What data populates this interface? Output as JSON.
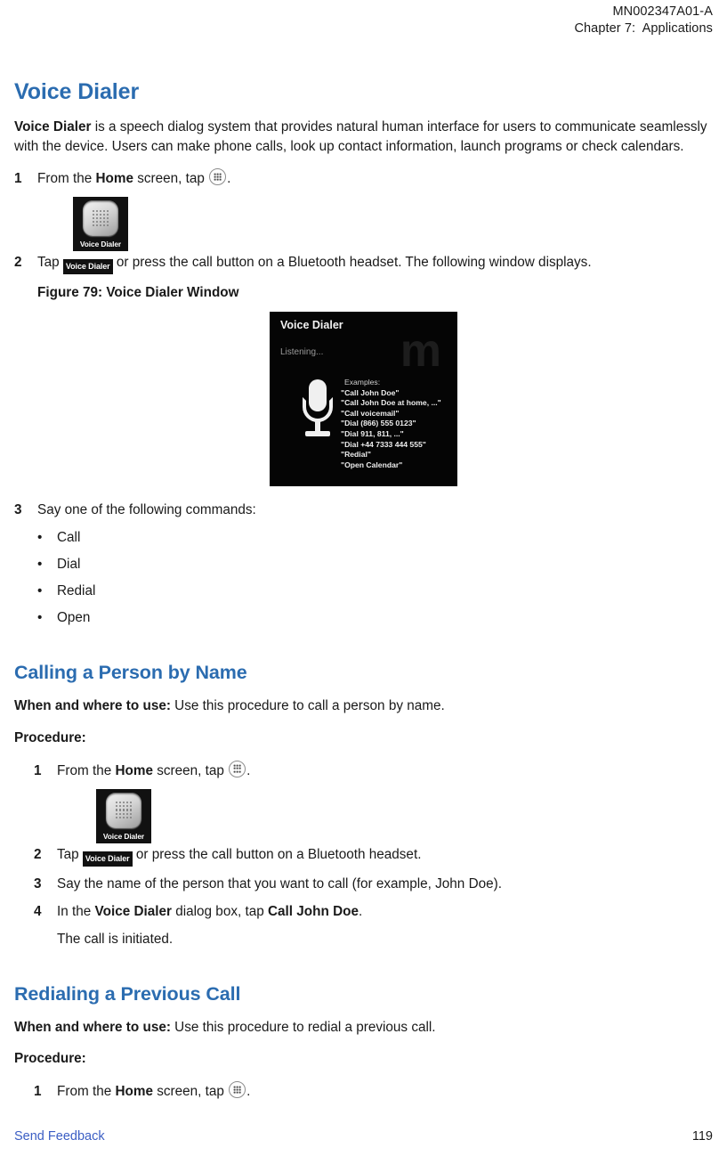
{
  "header": {
    "doc_number": "MN002347A01-A",
    "chapter": "Chapter 7:  Applications"
  },
  "section_voice_dialer": {
    "title": "Voice Dialer",
    "intro_bold": "Voice Dialer",
    "intro_rest": " is a speech dialog system that provides natural human interface for users to communicate seamlessly with the device. Users can make phone calls, look up contact information, launch programs or check calendars.",
    "step1": {
      "num": "1",
      "pre": "From the ",
      "bold": "Home",
      "post": " screen, tap "
    },
    "step2": {
      "num": "2",
      "pre": "Tap ",
      "tile_label": "Voice Dialer",
      "post": " or press the call button on a Bluetooth headset. The following window displays."
    },
    "figure_caption": "Figure 79: Voice Dialer Window",
    "step3": {
      "num": "3",
      "text": "Say one of the following commands:"
    },
    "commands": [
      "Call",
      "Dial",
      "Redial",
      "Open"
    ],
    "app_tile_label": "Voice Dialer"
  },
  "voice_dialer_window": {
    "title": "Voice Dialer",
    "status": "Listening...",
    "examples_heading": "Examples:",
    "examples": [
      "\"Call John Doe\"",
      "\"Call John Doe at home, ...\"",
      "\"Call voicemail\"",
      "\"Dial (866) 555 0123\"",
      "\"Dial 911, 811, ...\"",
      "\"Dial +44 7333 444 555\"",
      "\"Redial\"",
      "\"Open Calendar\""
    ],
    "watermark": "m"
  },
  "section_calling_by_name": {
    "title": "Calling a Person by Name",
    "lead_bold": "When and where to use:",
    "lead_rest": " Use this procedure to call a person by name.",
    "procedure_label": "Procedure:",
    "app_tile_label": "Voice Dialer",
    "step1": {
      "num": "1",
      "pre": "From the ",
      "bold": "Home",
      "post": " screen, tap "
    },
    "step2": {
      "num": "2",
      "pre": "Tap ",
      "tile_label": "Voice Dialer",
      "post": " or press the call button on a Bluetooth headset."
    },
    "step3": {
      "num": "3",
      "text": "Say the name of the person that you want to call (for example, John Doe)."
    },
    "step4": {
      "num": "4",
      "pre": "In the ",
      "bold1": "Voice Dialer",
      "mid": " dialog box, tap ",
      "bold2": "Call John Doe",
      "post": "."
    },
    "result": "The call is initiated."
  },
  "section_redialing": {
    "title": "Redialing a Previous Call",
    "lead_bold": "When and where to use:",
    "lead_rest": " Use this procedure to redial a previous call.",
    "procedure_label": "Procedure:",
    "step1": {
      "num": "1",
      "pre": "From the ",
      "bold": "Home",
      "post": " screen, tap "
    }
  },
  "footer": {
    "feedback": "Send Feedback",
    "page_number": "119"
  },
  "colors": {
    "heading_blue": "#2b6cb0",
    "link_blue": "#3b5ec4",
    "text": "#1a1a1a"
  }
}
